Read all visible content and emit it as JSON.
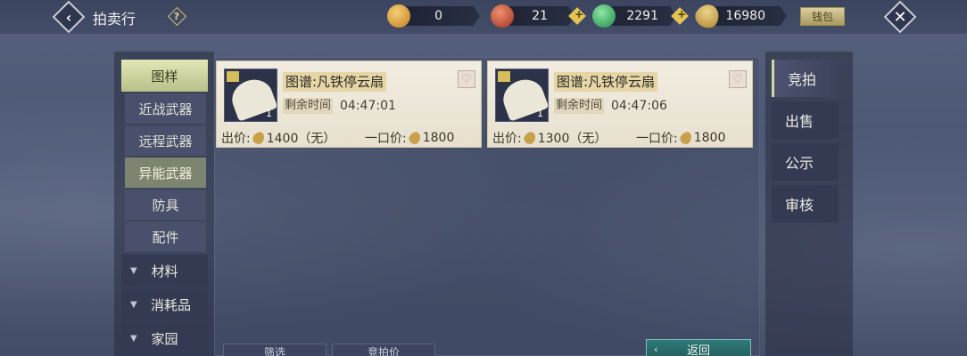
{
  "header": {
    "title": "拍卖行",
    "help_label": "?",
    "wallet_label": "钱包"
  },
  "currencies": [
    {
      "name": "gold-token",
      "value": "0",
      "color": "#e3a23a"
    },
    {
      "name": "red-orb",
      "value": "21",
      "color": "#c8473a"
    },
    {
      "name": "jade-orb",
      "value": "2291",
      "color": "#3fb56a"
    },
    {
      "name": "gold-leaf",
      "value": "16980",
      "color": "#c9a04c"
    }
  ],
  "categories": {
    "main_active": "图样",
    "subs": [
      "近战武器",
      "远程武器",
      "异能武器",
      "防具",
      "配件"
    ],
    "active_sub": "异能武器",
    "collapsed": [
      "材料",
      "消耗品",
      "家园"
    ]
  },
  "listings": [
    {
      "name": "图谱:凡铁停云扇",
      "time_label": "剩余时间",
      "time": "04:47:01",
      "qty": "1",
      "bid_label": "出价:",
      "bid": "1400（无）",
      "buyout_label": "一口价:",
      "buyout": "1800"
    },
    {
      "name": "图谱:凡铁停云扇",
      "time_label": "剩余时间",
      "time": "04:47:06",
      "qty": "1",
      "bid_label": "出价:",
      "bid": "1300（无）",
      "buyout_label": "一口价:",
      "buyout": "1800"
    }
  ],
  "right_tabs": [
    "竞拍",
    "出售",
    "公示",
    "审核"
  ],
  "bottom": {
    "filter_label": "筛选",
    "sort_label": "竞拍价",
    "return_label": "返回"
  }
}
